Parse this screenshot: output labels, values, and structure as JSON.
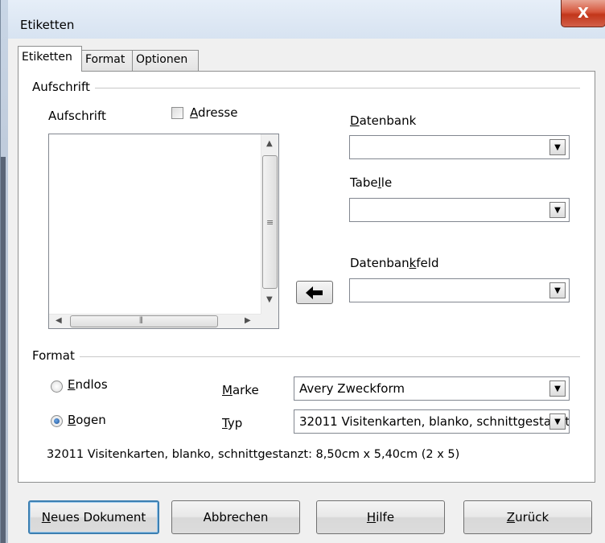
{
  "window": {
    "title": "Etiketten",
    "close_symbol": "X"
  },
  "tabs": [
    {
      "label": "Etiketten",
      "active": true
    },
    {
      "label": "Format",
      "active": false
    },
    {
      "label": "Optionen",
      "active": false
    }
  ],
  "aufschrift_section": {
    "title": "Aufschrift",
    "label": "Aufschrift",
    "address_checkbox": {
      "label_mnemonic": "A",
      "label_rest": "dresse",
      "checked": false
    },
    "text_value": ""
  },
  "database": {
    "datenbank_mnemonic": "D",
    "datenbank_rest": "atenbank",
    "datenbank_value": "",
    "tabelle_pre": "Tabe",
    "tabelle_mnemonic": "l",
    "tabelle_post": "le",
    "tabelle_value": "",
    "feld_pre": "Datenban",
    "feld_mnemonic": "k",
    "feld_post": "feld",
    "feld_value": "",
    "insert_icon": "arrow-left-icon"
  },
  "format_section": {
    "title": "Format",
    "endlos": {
      "mnemonic": "E",
      "rest": "ndlos",
      "checked": false
    },
    "bogen": {
      "mnemonic": "B",
      "rest": "ogen",
      "checked": true
    },
    "marke": {
      "mnemonic": "M",
      "rest": "arke",
      "value": "Avery Zweckform"
    },
    "typ": {
      "mnemonic": "T",
      "rest": "yp",
      "value": "32011 Visitenkarten, blanko, schnittgestanzt"
    },
    "description": "32011 Visitenkarten, blanko, schnittgestanzt: 8,50cm x 5,40cm (2 x 5)"
  },
  "buttons": {
    "neues_mnemonic": "N",
    "neues_rest": "eues Dokument",
    "abbrechen": "Abbrechen",
    "hilfe_mnemonic": "H",
    "hilfe_rest": "ilfe",
    "zurueck_mnemonic": "Z",
    "zurueck_rest": "urück"
  },
  "colors": {
    "accent": "#3c7fb1",
    "close_red": "#c2361a"
  }
}
